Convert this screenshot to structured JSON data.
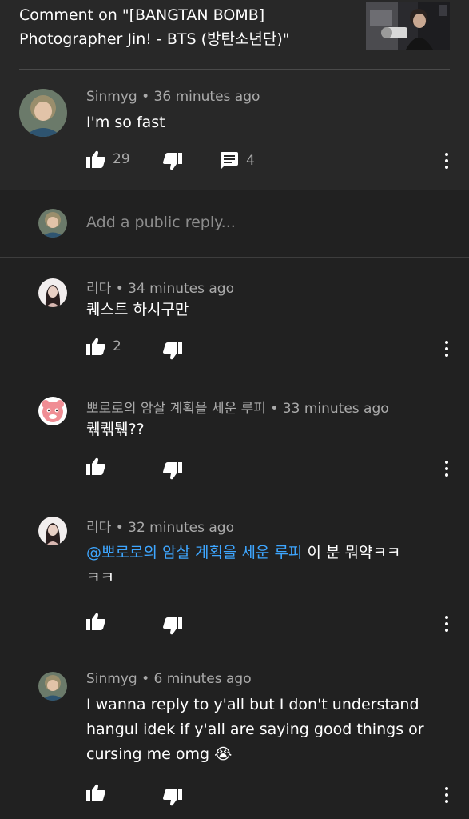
{
  "header": {
    "title": "Comment on \"[BANGTAN BOMB] Photographer Jin! - BTS (방탄소년단)\"",
    "thumbnail_icon": "video-thumbnail"
  },
  "parent_comment": {
    "author": "Sinmyg",
    "time": "36 minutes ago",
    "text": "I'm so fast",
    "likes": "29",
    "replies": "4"
  },
  "reply_box": {
    "placeholder": "Add a public reply..."
  },
  "replies": [
    {
      "author": "리다",
      "time": "34 minutes ago",
      "text": "퀘스트 하시구만",
      "likes": "2"
    },
    {
      "author": "뽀로로의 암살 계획을 세운 루피",
      "time": "33 minutes ago",
      "text": "퀚퀚퉦??",
      "likes": ""
    },
    {
      "author": "리다",
      "time": "32 minutes ago",
      "mention": "@뽀로로의 암살 계획을 세운 루피",
      "text_after_mention": " 이 분 뭐약ㅋㅋ",
      "text_line2": "ㅋㅋ",
      "likes": ""
    },
    {
      "author": "Sinmyg",
      "time": "6 minutes ago",
      "text_line1": "I wanna reply to y'all but I don't understand",
      "text_line2": "hangul idek if y'all are saying good things or",
      "text_line3": "cursing me omg 😭",
      "likes": ""
    }
  ],
  "colors": {
    "background_top": "#282828",
    "background_replies": "#212121",
    "meta_gray": "#aaaaaa",
    "mention_blue": "#3ea6ff"
  }
}
